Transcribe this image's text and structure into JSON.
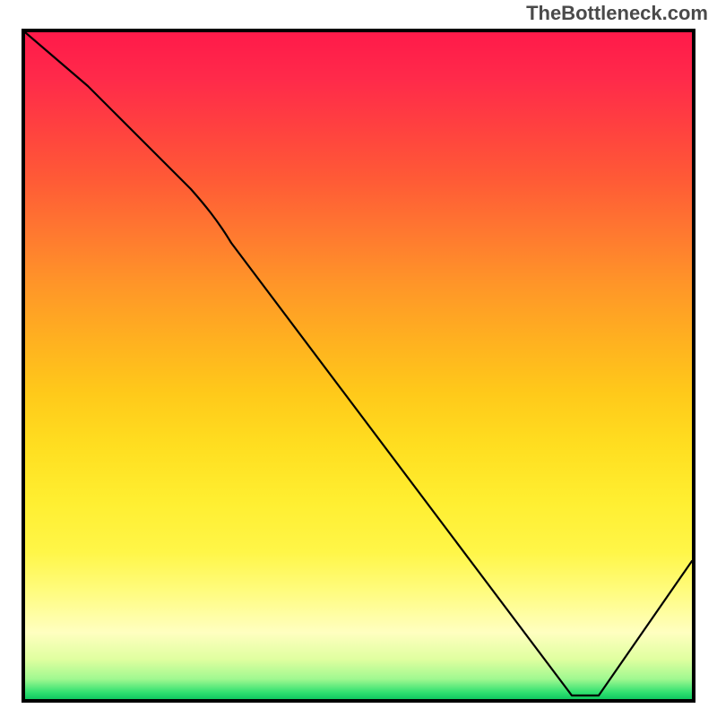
{
  "watermark": "TheBottleneck.com",
  "chart_data": {
    "type": "line",
    "title": "",
    "xlabel": "",
    "ylabel": "",
    "xlim": [
      0,
      100
    ],
    "ylim": [
      0,
      100
    ],
    "grid": false,
    "legend": false,
    "description": "Bottleneck mismatch curve over a vertical red-to-green gradient. Curve descends from top-left, reaches a minimum near x≈82 at y≈0 (optimal, green), then rises toward the right edge.",
    "series": [
      {
        "name": "bottleneck-curve",
        "x": [
          0,
          9,
          17,
          25,
          31,
          40,
          50,
          60,
          70,
          78,
          82,
          86,
          100
        ],
        "values": [
          100,
          92,
          84,
          77,
          69,
          55,
          40,
          27,
          14,
          4,
          0,
          0,
          20
        ]
      }
    ],
    "gradient_stops": [
      {
        "pos": 0,
        "color": "#ff1a4a"
      },
      {
        "pos": 50,
        "color": "#ffcc20"
      },
      {
        "pos": 85,
        "color": "#ffff90"
      },
      {
        "pos": 100,
        "color": "#10c860"
      }
    ],
    "annotations": [
      {
        "text": "",
        "x": 82,
        "y": 1,
        "note": "small red label at curve valley, illegible in source"
      }
    ]
  }
}
